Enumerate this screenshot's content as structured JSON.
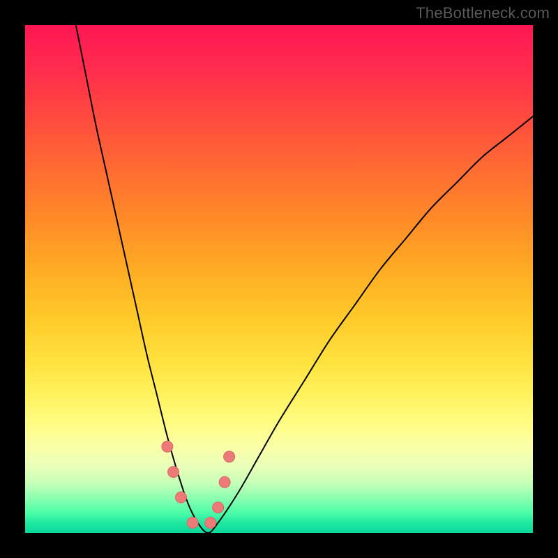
{
  "watermark": "TheBottleneck.com",
  "chart_data": {
    "type": "line",
    "title": "",
    "xlabel": "",
    "ylabel": "",
    "xlim": [
      0,
      100
    ],
    "ylim": [
      0,
      100
    ],
    "grid": false,
    "series": [
      {
        "name": "bottleneck-curve",
        "x": [
          10,
          12,
          14,
          16,
          18,
          20,
          22,
          24,
          26,
          28,
          30,
          32,
          34,
          36,
          38,
          42,
          46,
          50,
          55,
          60,
          65,
          70,
          75,
          80,
          85,
          90,
          95,
          100
        ],
        "values": [
          100,
          90,
          80,
          71,
          62,
          53,
          44,
          35,
          27,
          19,
          12,
          6,
          2,
          0,
          2,
          8,
          15,
          22,
          30,
          38,
          45,
          52,
          58,
          64,
          69,
          74,
          78,
          82
        ]
      }
    ],
    "markers": {
      "name": "highlight-points",
      "x": [
        28.0,
        29.2,
        30.7,
        33.0,
        36.5,
        38.0,
        39.3,
        40.2
      ],
      "values": [
        17,
        12,
        7,
        2,
        2,
        5,
        10,
        15
      ],
      "color": "#ec7a79"
    },
    "background_gradient": {
      "orientation": "vertical",
      "stops": [
        {
          "pos": 0.0,
          "color": "#ff1753"
        },
        {
          "pos": 0.28,
          "color": "#ff6a33"
        },
        {
          "pos": 0.58,
          "color": "#ffcb2a"
        },
        {
          "pos": 0.78,
          "color": "#fffc80"
        },
        {
          "pos": 0.93,
          "color": "#8effb0"
        },
        {
          "pos": 1.0,
          "color": "#0cd79c"
        }
      ]
    }
  }
}
